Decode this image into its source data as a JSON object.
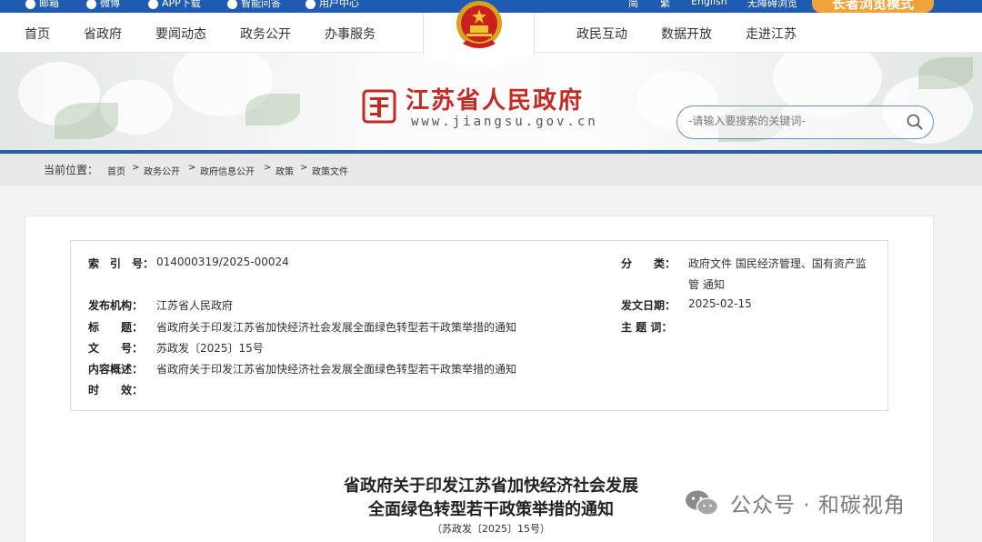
{
  "topbar": {
    "links": [
      "邮箱",
      "微博",
      "APP下载",
      "智能问答",
      "用户中心"
    ],
    "right_links": [
      "简",
      "繁",
      "English",
      "无障碍浏览"
    ],
    "elder_mode": "长者浏览模式"
  },
  "nav": {
    "left": [
      "首页",
      "省政府",
      "要闻动态",
      "政务公开",
      "办事服务"
    ],
    "right": [
      "政民互动",
      "数据开放",
      "走进江苏"
    ]
  },
  "header": {
    "site_title": "江苏省人民政府",
    "site_url": "www.jiangsu.gov.cn",
    "search_placeholder": "-请输入要搜索的关键词-"
  },
  "breadcrumb": {
    "label": "当前位置：",
    "items": [
      "首页",
      "政务公开",
      "政府信息公开",
      "政策",
      "政策文件"
    ]
  },
  "meta": {
    "index_label": "索　引　号：",
    "index_value": "014000319/2025-00024",
    "category_label": "分　　类：",
    "category_line1": "政府文件 国民经济管理、国有资产监",
    "category_line2": "管 通知",
    "publisher_label": "发布机构：",
    "publisher_value": "江苏省人民政府",
    "date_label": "发文日期：",
    "date_value": "2025-02-15",
    "title_label": "标　　题：",
    "title_value": "省政府关于印发江苏省加快经济社会发展全面绿色转型若干政策举措的通知",
    "subject_label": "主 题 词：",
    "subject_value": "",
    "docno_label": "文　　号：",
    "docno_value": "苏政发〔2025〕15号",
    "summary_label": "内容概述：",
    "summary_value": "省政府关于印发江苏省加快经济社会发展全面绿色转型若干政策举措的通知",
    "validity_label": "时　　效：",
    "validity_value": ""
  },
  "document": {
    "title_line1": "省政府关于印发江苏省加快经济社会发展",
    "title_line2": "全面绿色转型若干政策举措的通知",
    "number": "（苏政发〔2025〕15号）"
  },
  "watermark": {
    "text": "公众号 · 和碳视角"
  },
  "colors": {
    "topbar": "#1f5bb0",
    "accent_red": "#c42a23",
    "elder_orange": "#f0a33a",
    "search_border": "#6a8fc4"
  },
  "icons": [
    "mail-icon",
    "weibo-icon",
    "phone-icon",
    "chat-icon",
    "user-icon",
    "national-emblem",
    "jiangsu-logo-icon",
    "search-icon",
    "wechat-icon"
  ]
}
